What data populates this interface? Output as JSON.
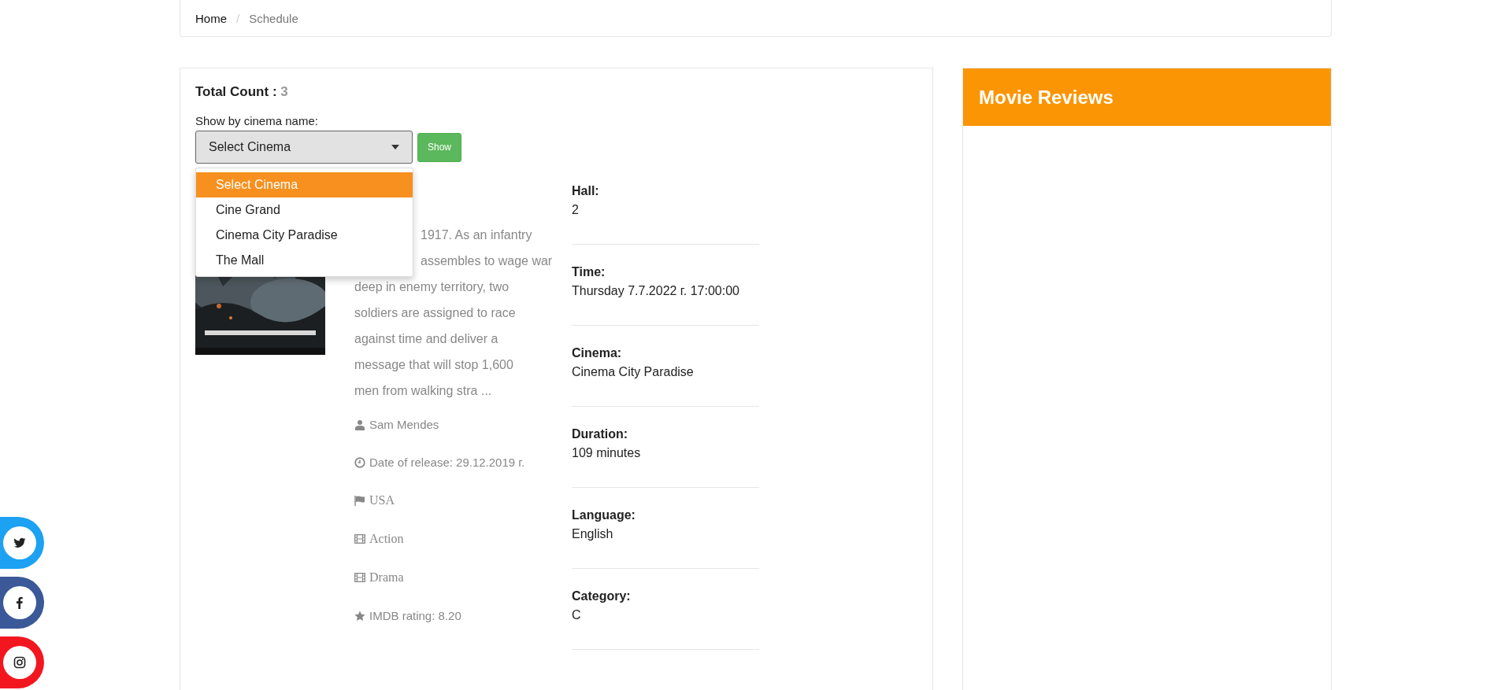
{
  "breadcrumb_separator": "/",
  "breadcrumb": [
    {
      "label": "Home",
      "current": false
    },
    {
      "label": "Schedule",
      "current": true
    }
  ],
  "total_count": {
    "label": "Total Count :",
    "value": "3"
  },
  "cinema_filter": {
    "label": "Show by cinema name:",
    "value": "Select Cinema",
    "button": "Show",
    "expanded": true,
    "options": [
      {
        "label": "Select Cinema",
        "selected": true
      },
      {
        "label": "Cine Grand",
        "selected": false
      },
      {
        "label": "Cinema City Paradise",
        "selected": false
      },
      {
        "label": "The Mall",
        "selected": false
      }
    ]
  },
  "movie": {
    "description_lines": [
      {
        "text": "1917. As an infantry",
        "indented": true
      },
      {
        "text": "assembles to wage war",
        "indented": true
      },
      {
        "text": "deep in enemy territory, two",
        "indented": false
      },
      {
        "text": "soldiers are assigned to race",
        "indented": false
      },
      {
        "text": "against time and deliver a",
        "indented": false
      },
      {
        "text": "message that will stop 1,600",
        "indented": false
      },
      {
        "text": "men from walking stra ...",
        "indented": false
      }
    ],
    "meta": [
      {
        "kind": "director",
        "text": "Sam Mendes"
      },
      {
        "kind": "date",
        "text": "Date of release: 29.12.2019 г."
      },
      {
        "kind": "country",
        "text": "USA"
      },
      {
        "kind": "genre",
        "text": "Action"
      },
      {
        "kind": "genre",
        "text": "Drama"
      },
      {
        "kind": "rating",
        "text": "IMDB rating: 8.20"
      }
    ]
  },
  "details": [
    {
      "label": "Hall:",
      "value": "2"
    },
    {
      "label": "Time:",
      "value": "Thursday 7.7.2022 г. 17:00:00"
    },
    {
      "label": "Cinema:",
      "value": "Cinema City Paradise"
    },
    {
      "label": "Duration:",
      "value": "109 minutes"
    },
    {
      "label": "Language:",
      "value": "English"
    },
    {
      "label": "Category:",
      "value": "C"
    }
  ],
  "reviews": {
    "title": "Movie Reviews"
  },
  "social": [
    {
      "kind": "twitter",
      "color": "#1da1f2"
    },
    {
      "kind": "facebook",
      "color": "#3b5998"
    },
    {
      "kind": "instagram",
      "color": "#f2171f"
    }
  ]
}
